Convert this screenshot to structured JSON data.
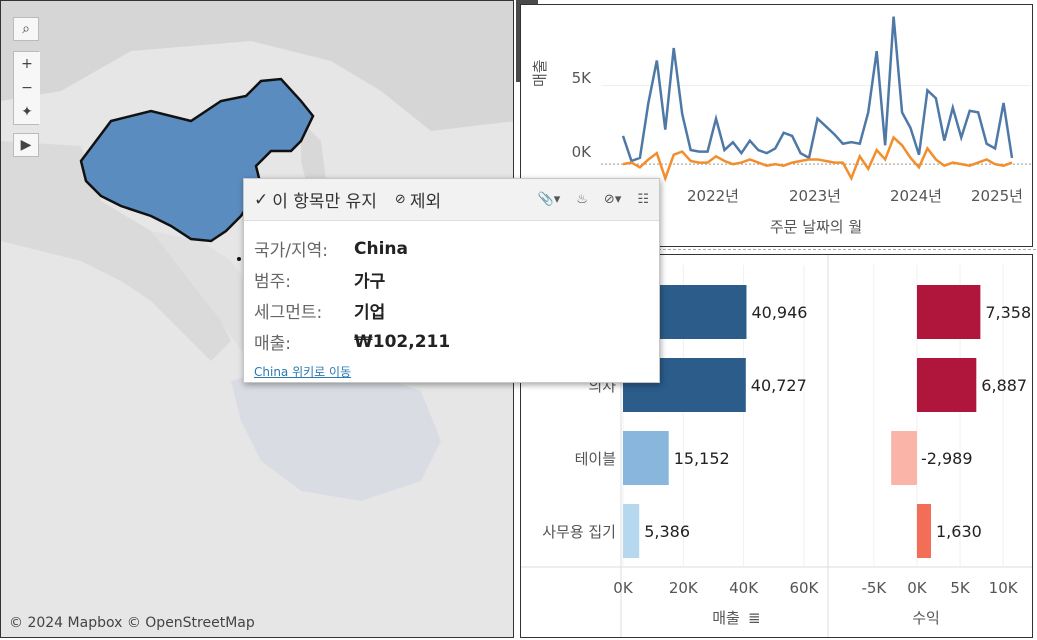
{
  "map": {
    "attribution": "© 2024 Mapbox © OpenStreetMap",
    "tools": {
      "search": "search-icon",
      "zoom_in": "+",
      "zoom_out": "−",
      "pin": "pin-icon",
      "play": "play-icon"
    },
    "highlight_color": "#5b8cc0",
    "selected_country": "China"
  },
  "side_toolbar": {
    "icons": [
      "close-icon",
      "popout-icon",
      "filter-icon",
      "more-icon"
    ]
  },
  "tooltip": {
    "keep_only_label": "이 항목만 유지",
    "exclude_label": "제외",
    "rows": [
      {
        "key": "국가/지역:",
        "value": "China"
      },
      {
        "key": "범주:",
        "value": "가구"
      },
      {
        "key": "세그먼트:",
        "value": "기업"
      },
      {
        "key": "매출:",
        "value": "₩102,211"
      }
    ],
    "link": "China 위키로 이동"
  },
  "chart_data": [
    {
      "type": "line",
      "title": "",
      "xlabel": "주문 날짜의 월",
      "ylabel": "매출",
      "x_ticks": [
        "2022년",
        "2023년",
        "2024년",
        "2025년"
      ],
      "y_ticks": [
        "5K",
        "0K"
      ],
      "ylim": [
        -1200,
        9500
      ],
      "x": [
        "2021-03",
        "2021-04",
        "2021-05",
        "2021-06",
        "2021-07",
        "2021-08",
        "2021-09",
        "2021-10",
        "2021-11",
        "2021-12",
        "2022-01",
        "2022-02",
        "2022-03",
        "2022-04",
        "2022-05",
        "2022-06",
        "2022-07",
        "2022-08",
        "2022-09",
        "2022-10",
        "2022-11",
        "2022-12",
        "2023-01",
        "2023-02",
        "2023-03",
        "2023-04",
        "2023-05",
        "2023-06",
        "2023-07",
        "2023-08",
        "2023-09",
        "2023-10",
        "2023-11",
        "2023-12",
        "2024-01",
        "2024-02",
        "2024-03",
        "2024-04",
        "2024-05",
        "2024-06",
        "2024-07",
        "2024-08",
        "2024-09",
        "2024-10",
        "2024-11",
        "2024-12",
        "2025-01"
      ],
      "series": [
        {
          "name": "매출",
          "color": "#4e79a7",
          "values": [
            1800,
            200,
            400,
            3900,
            6600,
            2200,
            7400,
            3200,
            900,
            800,
            800,
            2900,
            900,
            1400,
            700,
            1500,
            900,
            700,
            1000,
            2000,
            1800,
            700,
            400,
            2900,
            2400,
            1900,
            1300,
            1400,
            1300,
            3300,
            7200,
            1200,
            9400,
            3300,
            2300,
            600,
            4700,
            4200,
            1500,
            3600,
            1700,
            3400,
            3300,
            1300,
            1000,
            3900,
            400
          ]
        },
        {
          "name": "수익",
          "color": "#f28e2b",
          "values": [
            0,
            100,
            -200,
            300,
            700,
            -900,
            600,
            800,
            200,
            100,
            100,
            500,
            200,
            0,
            100,
            300,
            100,
            -100,
            0,
            -100,
            100,
            200,
            300,
            300,
            200,
            100,
            100,
            -900,
            500,
            -300,
            900,
            300,
            1700,
            1200,
            400,
            -200,
            1000,
            300,
            -100,
            100,
            0,
            -100,
            100,
            300,
            0,
            -100,
            100
          ]
        }
      ]
    },
    {
      "type": "bar",
      "orientation": "horizontal",
      "categories": [
        "",
        "의자",
        "테이블",
        "사무용 집기"
      ],
      "series": [
        {
          "name": "매출",
          "values": [
            40946,
            40727,
            15152,
            5386
          ],
          "labels": [
            "40,946",
            "40,727",
            "15,152",
            "5,386"
          ],
          "colors": [
            "#2b5c8a",
            "#2b5c8a",
            "#89b6dc",
            "#b6d8ee"
          ],
          "x_ticks": [
            "0K",
            "20K",
            "40K",
            "60K"
          ],
          "xlim": [
            0,
            65000
          ],
          "axis_label": "매출"
        },
        {
          "name": "수익",
          "values": [
            7358,
            6887,
            -2989,
            1630
          ],
          "labels": [
            "7,358",
            "6,887",
            "-2,989",
            "1,630"
          ],
          "colors": [
            "#b0163b",
            "#b0163b",
            "#fab5a8",
            "#f26e57"
          ],
          "x_ticks": [
            "-5K",
            "0K",
            "5K",
            "10K"
          ],
          "xlim": [
            -8000,
            13000
          ],
          "axis_label": "수익"
        }
      ]
    }
  ]
}
